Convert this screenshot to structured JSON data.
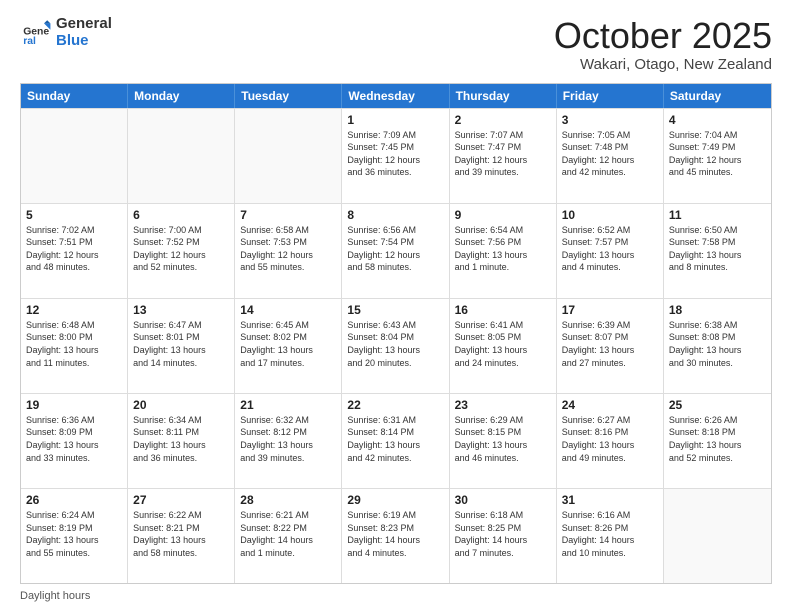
{
  "logo": {
    "general": "General",
    "blue": "Blue"
  },
  "header": {
    "month": "October 2025",
    "location": "Wakari, Otago, New Zealand"
  },
  "days_of_week": [
    "Sunday",
    "Monday",
    "Tuesday",
    "Wednesday",
    "Thursday",
    "Friday",
    "Saturday"
  ],
  "weeks": [
    [
      {
        "day": "",
        "info": ""
      },
      {
        "day": "",
        "info": ""
      },
      {
        "day": "",
        "info": ""
      },
      {
        "day": "1",
        "info": "Sunrise: 7:09 AM\nSunset: 7:45 PM\nDaylight: 12 hours\nand 36 minutes."
      },
      {
        "day": "2",
        "info": "Sunrise: 7:07 AM\nSunset: 7:47 PM\nDaylight: 12 hours\nand 39 minutes."
      },
      {
        "day": "3",
        "info": "Sunrise: 7:05 AM\nSunset: 7:48 PM\nDaylight: 12 hours\nand 42 minutes."
      },
      {
        "day": "4",
        "info": "Sunrise: 7:04 AM\nSunset: 7:49 PM\nDaylight: 12 hours\nand 45 minutes."
      }
    ],
    [
      {
        "day": "5",
        "info": "Sunrise: 7:02 AM\nSunset: 7:51 PM\nDaylight: 12 hours\nand 48 minutes."
      },
      {
        "day": "6",
        "info": "Sunrise: 7:00 AM\nSunset: 7:52 PM\nDaylight: 12 hours\nand 52 minutes."
      },
      {
        "day": "7",
        "info": "Sunrise: 6:58 AM\nSunset: 7:53 PM\nDaylight: 12 hours\nand 55 minutes."
      },
      {
        "day": "8",
        "info": "Sunrise: 6:56 AM\nSunset: 7:54 PM\nDaylight: 12 hours\nand 58 minutes."
      },
      {
        "day": "9",
        "info": "Sunrise: 6:54 AM\nSunset: 7:56 PM\nDaylight: 13 hours\nand 1 minute."
      },
      {
        "day": "10",
        "info": "Sunrise: 6:52 AM\nSunset: 7:57 PM\nDaylight: 13 hours\nand 4 minutes."
      },
      {
        "day": "11",
        "info": "Sunrise: 6:50 AM\nSunset: 7:58 PM\nDaylight: 13 hours\nand 8 minutes."
      }
    ],
    [
      {
        "day": "12",
        "info": "Sunrise: 6:48 AM\nSunset: 8:00 PM\nDaylight: 13 hours\nand 11 minutes."
      },
      {
        "day": "13",
        "info": "Sunrise: 6:47 AM\nSunset: 8:01 PM\nDaylight: 13 hours\nand 14 minutes."
      },
      {
        "day": "14",
        "info": "Sunrise: 6:45 AM\nSunset: 8:02 PM\nDaylight: 13 hours\nand 17 minutes."
      },
      {
        "day": "15",
        "info": "Sunrise: 6:43 AM\nSunset: 8:04 PM\nDaylight: 13 hours\nand 20 minutes."
      },
      {
        "day": "16",
        "info": "Sunrise: 6:41 AM\nSunset: 8:05 PM\nDaylight: 13 hours\nand 24 minutes."
      },
      {
        "day": "17",
        "info": "Sunrise: 6:39 AM\nSunset: 8:07 PM\nDaylight: 13 hours\nand 27 minutes."
      },
      {
        "day": "18",
        "info": "Sunrise: 6:38 AM\nSunset: 8:08 PM\nDaylight: 13 hours\nand 30 minutes."
      }
    ],
    [
      {
        "day": "19",
        "info": "Sunrise: 6:36 AM\nSunset: 8:09 PM\nDaylight: 13 hours\nand 33 minutes."
      },
      {
        "day": "20",
        "info": "Sunrise: 6:34 AM\nSunset: 8:11 PM\nDaylight: 13 hours\nand 36 minutes."
      },
      {
        "day": "21",
        "info": "Sunrise: 6:32 AM\nSunset: 8:12 PM\nDaylight: 13 hours\nand 39 minutes."
      },
      {
        "day": "22",
        "info": "Sunrise: 6:31 AM\nSunset: 8:14 PM\nDaylight: 13 hours\nand 42 minutes."
      },
      {
        "day": "23",
        "info": "Sunrise: 6:29 AM\nSunset: 8:15 PM\nDaylight: 13 hours\nand 46 minutes."
      },
      {
        "day": "24",
        "info": "Sunrise: 6:27 AM\nSunset: 8:16 PM\nDaylight: 13 hours\nand 49 minutes."
      },
      {
        "day": "25",
        "info": "Sunrise: 6:26 AM\nSunset: 8:18 PM\nDaylight: 13 hours\nand 52 minutes."
      }
    ],
    [
      {
        "day": "26",
        "info": "Sunrise: 6:24 AM\nSunset: 8:19 PM\nDaylight: 13 hours\nand 55 minutes."
      },
      {
        "day": "27",
        "info": "Sunrise: 6:22 AM\nSunset: 8:21 PM\nDaylight: 13 hours\nand 58 minutes."
      },
      {
        "day": "28",
        "info": "Sunrise: 6:21 AM\nSunset: 8:22 PM\nDaylight: 14 hours\nand 1 minute."
      },
      {
        "day": "29",
        "info": "Sunrise: 6:19 AM\nSunset: 8:23 PM\nDaylight: 14 hours\nand 4 minutes."
      },
      {
        "day": "30",
        "info": "Sunrise: 6:18 AM\nSunset: 8:25 PM\nDaylight: 14 hours\nand 7 minutes."
      },
      {
        "day": "31",
        "info": "Sunrise: 6:16 AM\nSunset: 8:26 PM\nDaylight: 14 hours\nand 10 minutes."
      },
      {
        "day": "",
        "info": ""
      }
    ]
  ],
  "footer": {
    "label": "Daylight hours"
  }
}
